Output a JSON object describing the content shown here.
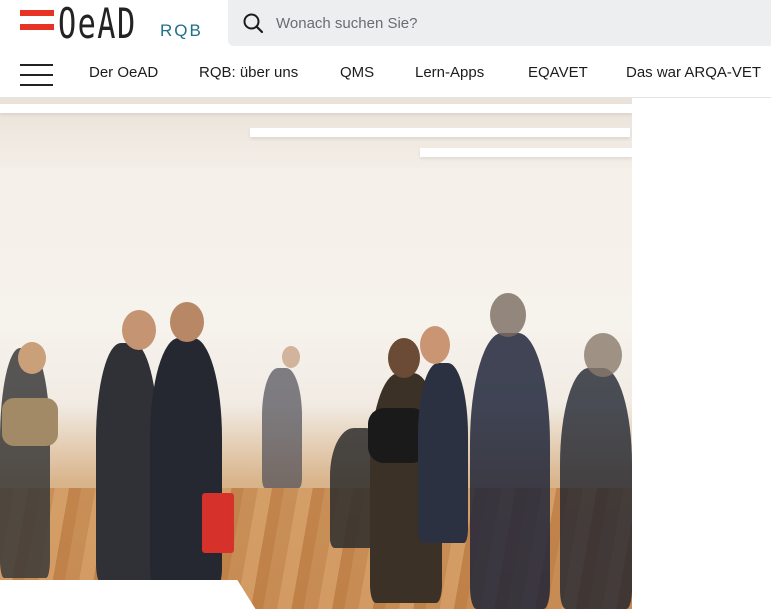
{
  "logo": {
    "brand": "OeAD",
    "sub": "RQB"
  },
  "search": {
    "placeholder": "Wonach suchen Sie?"
  },
  "nav": {
    "items": [
      {
        "label": "Der OeAD"
      },
      {
        "label": "RQB: über uns"
      },
      {
        "label": "QMS"
      },
      {
        "label": "Lern-Apps"
      },
      {
        "label": "EQAVET"
      },
      {
        "label": "Das war ARQA-VET"
      }
    ]
  },
  "colors": {
    "brand_red": "#e63323",
    "brand_teal": "#1f6f8b",
    "search_bg": "#eceef0"
  }
}
